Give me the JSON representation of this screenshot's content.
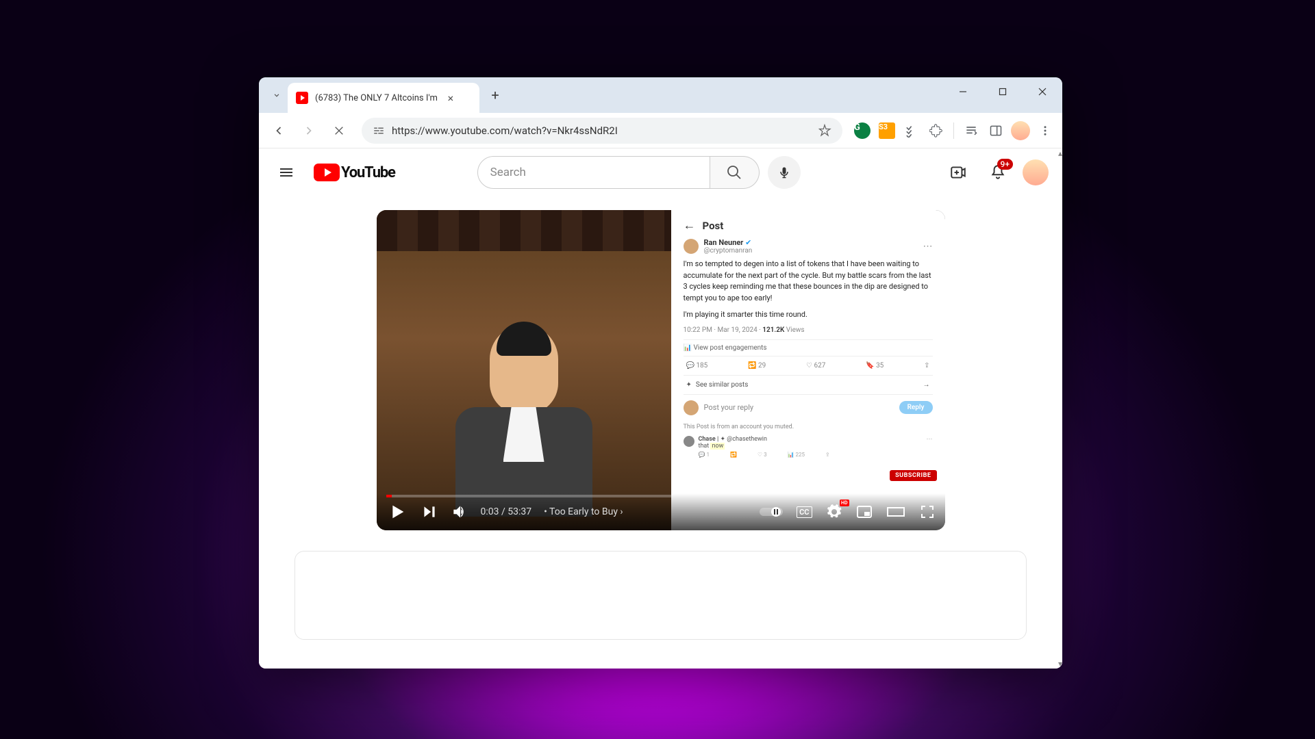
{
  "browser": {
    "tab_title": "(6783) The ONLY 7 Altcoins I'm",
    "url": "https://www.youtube.com/watch?v=Nkr4ssNdR2I"
  },
  "youtube": {
    "logo_text": "YouTube",
    "search_placeholder": "Search",
    "notification_count": "9+"
  },
  "player": {
    "current_time": "0:03",
    "duration": "53:37",
    "chapter": "Too Early to Buy"
  },
  "tweet": {
    "post_label": "Post",
    "name": "Ran Neuner",
    "handle": "@cryptomanran",
    "body_line1": "I'm so tempted to degen into a list of tokens that I have been waiting to accumulate for the next part of the cycle. But my battle scars from the last 3 cycles keep reminding me that these bounces in the dip are designed to tempt you to ape too early!",
    "body_line2": "I'm playing it smarter this time round.",
    "timestamp": "10:22 PM · Mar 19, 2024",
    "views": "121.2K",
    "views_label": "Views",
    "engagements": "View post engagements",
    "replies": "185",
    "retweets": "29",
    "likes": "627",
    "bookmarks": "35",
    "similar": "See similar posts",
    "reply_placeholder": "Post your reply",
    "reply_button": "Reply",
    "muted": "This Post is from an account you muted.",
    "subscribe": "SUBSCRIBE",
    "thread_name": "Chase |",
    "thread_handle": "@chasethewin",
    "thread_text": "that",
    "thread_now": "now",
    "thread_like": "3",
    "thread_view": "225"
  }
}
